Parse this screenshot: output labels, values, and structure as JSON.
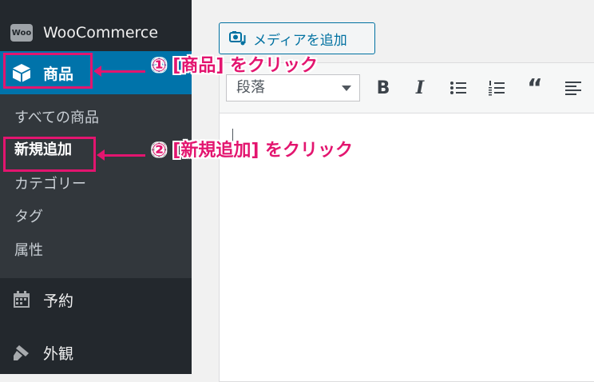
{
  "sidebar": {
    "woocommerce": {
      "label": "WooCommerce",
      "badge": "Woo"
    },
    "products": {
      "label": "商品"
    },
    "submenu": [
      {
        "label": "すべての商品"
      },
      {
        "label": "新規追加"
      },
      {
        "label": "カテゴリー"
      },
      {
        "label": "タグ"
      },
      {
        "label": "属性"
      }
    ],
    "booking": {
      "label": "予約"
    },
    "appearance": {
      "label": "外観"
    }
  },
  "editor": {
    "add_media_label": "メディアを追加",
    "format_select_value": "段落"
  },
  "annotations": {
    "step1": "① [商品] をクリック",
    "step2": "② [新規追加] をクリック"
  },
  "colors": {
    "sidebar_bg": "#23282d",
    "submenu_bg": "#32373c",
    "active_blue": "#0073aa",
    "annotation_pink": "#e3156f"
  }
}
